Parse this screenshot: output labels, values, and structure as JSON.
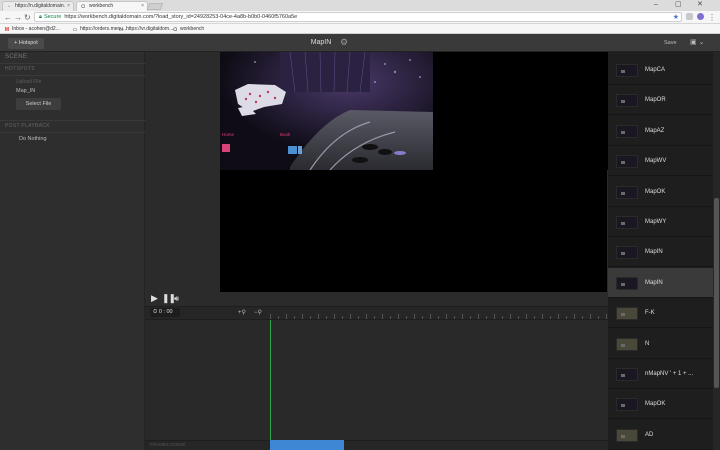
{
  "browser": {
    "tabs": [
      {
        "label": "https://n.digitaldomain.",
        "close": "×"
      },
      {
        "label": "workbench",
        "close": "×"
      }
    ],
    "url_secure": "Secure",
    "url": "https://workbench.digitaldomain.com/?load_story_id=24928253-04ce-4a8b-b0b0-0460f5760a5e",
    "bookmarks": [
      {
        "label": "Inbox - acohen@d2...",
        "icon": "M"
      },
      {
        "label": "https://orders.menu...",
        "icon": "▭"
      },
      {
        "label": "https://vr.digitaldom...",
        "icon": "▭"
      },
      {
        "label": "workbench",
        "icon": "ᗡ"
      }
    ]
  },
  "header": {
    "hotspot_button": "+ Hotspot",
    "title": "MapIN",
    "save": "Save"
  },
  "left": {
    "scene_title": "SCENE",
    "hotspots_title": "HOTSPOTS",
    "upload_label": "Upload File",
    "file_name": "Map_IN",
    "select_file": "Select File",
    "post_playback_title": "POST PLAYBACK",
    "post_playback_value": "Do Nothing"
  },
  "controls": {
    "time_mins": "0",
    "time_secs": "00",
    "zoom_in": "+⚲",
    "zoom_out": "−⚲",
    "footer_label": "FRAMES SCENE"
  },
  "scenes": [
    {
      "label": "MapCA",
      "selected": false,
      "lit": false
    },
    {
      "label": "MapOR",
      "selected": false,
      "lit": false
    },
    {
      "label": "MapAZ",
      "selected": false,
      "lit": false
    },
    {
      "label": "MapWV",
      "selected": false,
      "lit": false
    },
    {
      "label": "MapOK",
      "selected": false,
      "lit": false
    },
    {
      "label": "MapWY",
      "selected": false,
      "lit": false
    },
    {
      "label": "MapIN",
      "selected": false,
      "lit": false
    },
    {
      "label": "MapIN",
      "selected": true,
      "lit": false
    },
    {
      "label": "F-K",
      "selected": false,
      "lit": true
    },
    {
      "label": "N",
      "selected": false,
      "lit": true
    },
    {
      "label": "nMapNV ' + 1 + ...",
      "selected": false,
      "lit": false
    },
    {
      "label": "MapOK",
      "selected": false,
      "lit": false
    },
    {
      "label": "AD",
      "selected": false,
      "lit": true
    }
  ],
  "colors": {
    "accent_blue": "#3e87d5",
    "playhead_green": "#2fa44f",
    "secure_green": "#0b8043"
  }
}
